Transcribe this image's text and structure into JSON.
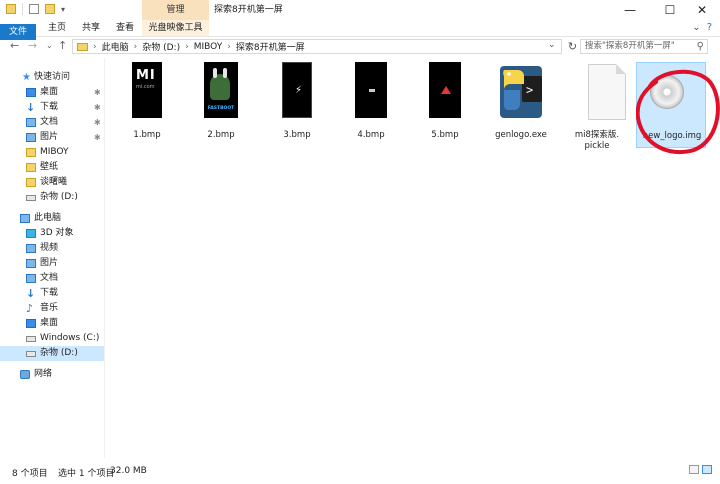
{
  "window": {
    "context_tab": "管理",
    "title": "探索8开机第一屏"
  },
  "ribbon": {
    "tabs": [
      {
        "label": "文件"
      },
      {
        "label": "主页"
      },
      {
        "label": "共享"
      },
      {
        "label": "查看"
      },
      {
        "label": "光盘映像工具"
      }
    ]
  },
  "address": {
    "crumbs": [
      "此电脑",
      "杂物 (D:)",
      "MIBOY",
      "探索8开机第一屏"
    ],
    "search_placeholder": "搜索\"探索8开机第一屏\""
  },
  "nav": {
    "quick_access": "快速访问",
    "quick_items": [
      "桌面",
      "下载",
      "文档",
      "图片",
      "MIBOY",
      "壁纸",
      "谈曙曦",
      "杂物 (D:)"
    ],
    "this_pc": "此电脑",
    "pc_items": [
      "3D 对象",
      "视频",
      "图片",
      "文档",
      "下载",
      "音乐",
      "桌面",
      "Windows (C:)",
      "杂物 (D:)"
    ],
    "network": "网络"
  },
  "files": [
    {
      "name": "1.bmp"
    },
    {
      "name": "2.bmp",
      "caption": "FASTBOOT"
    },
    {
      "name": "3.bmp"
    },
    {
      "name": "4.bmp"
    },
    {
      "name": "5.bmp"
    },
    {
      "name": "genlogo.exe"
    },
    {
      "name": "mi8探索版.",
      "name2": "pickle"
    },
    {
      "name": "new_logo.img"
    }
  ],
  "mi_logo": {
    "text": "MI",
    "sub": "mi.com"
  },
  "status": {
    "count": "8 个项目",
    "selected": "选中 1 个项目",
    "size": "32.0 MB"
  },
  "colors": {
    "accent": "#1979ca",
    "selection": "#cce8ff",
    "context_tab": "#f9e1bd",
    "annotation": "#e0102a"
  }
}
